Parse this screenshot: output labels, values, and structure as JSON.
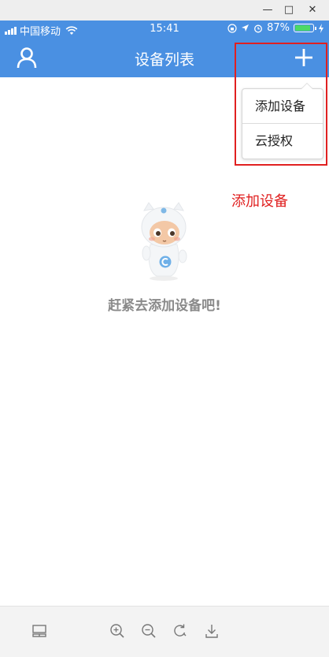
{
  "window": {
    "minimize_glyph": "—",
    "maximize_glyph": "□",
    "close_glyph": "✕"
  },
  "status_bar": {
    "carrier": "中国移动",
    "time": "15:41",
    "battery_percent": "87%",
    "battery_level": 0.87,
    "battery_color": "#4cd964"
  },
  "nav": {
    "title": "设备列表",
    "left_icon": "user-icon",
    "right_icon": "plus-icon",
    "background": "#4a90e2"
  },
  "dropdown": {
    "items": [
      {
        "label": "添加设备"
      },
      {
        "label": "云授权"
      }
    ]
  },
  "annotation": {
    "text": "添加设备",
    "color": "#e02020"
  },
  "empty_state": {
    "message": "赶紧去添加设备吧!",
    "illustration": "mascot-illustration"
  },
  "toolbar": {
    "icons": [
      "layout-icon",
      "zoom-in-icon",
      "zoom-out-icon",
      "rotate-icon",
      "download-icon"
    ]
  }
}
